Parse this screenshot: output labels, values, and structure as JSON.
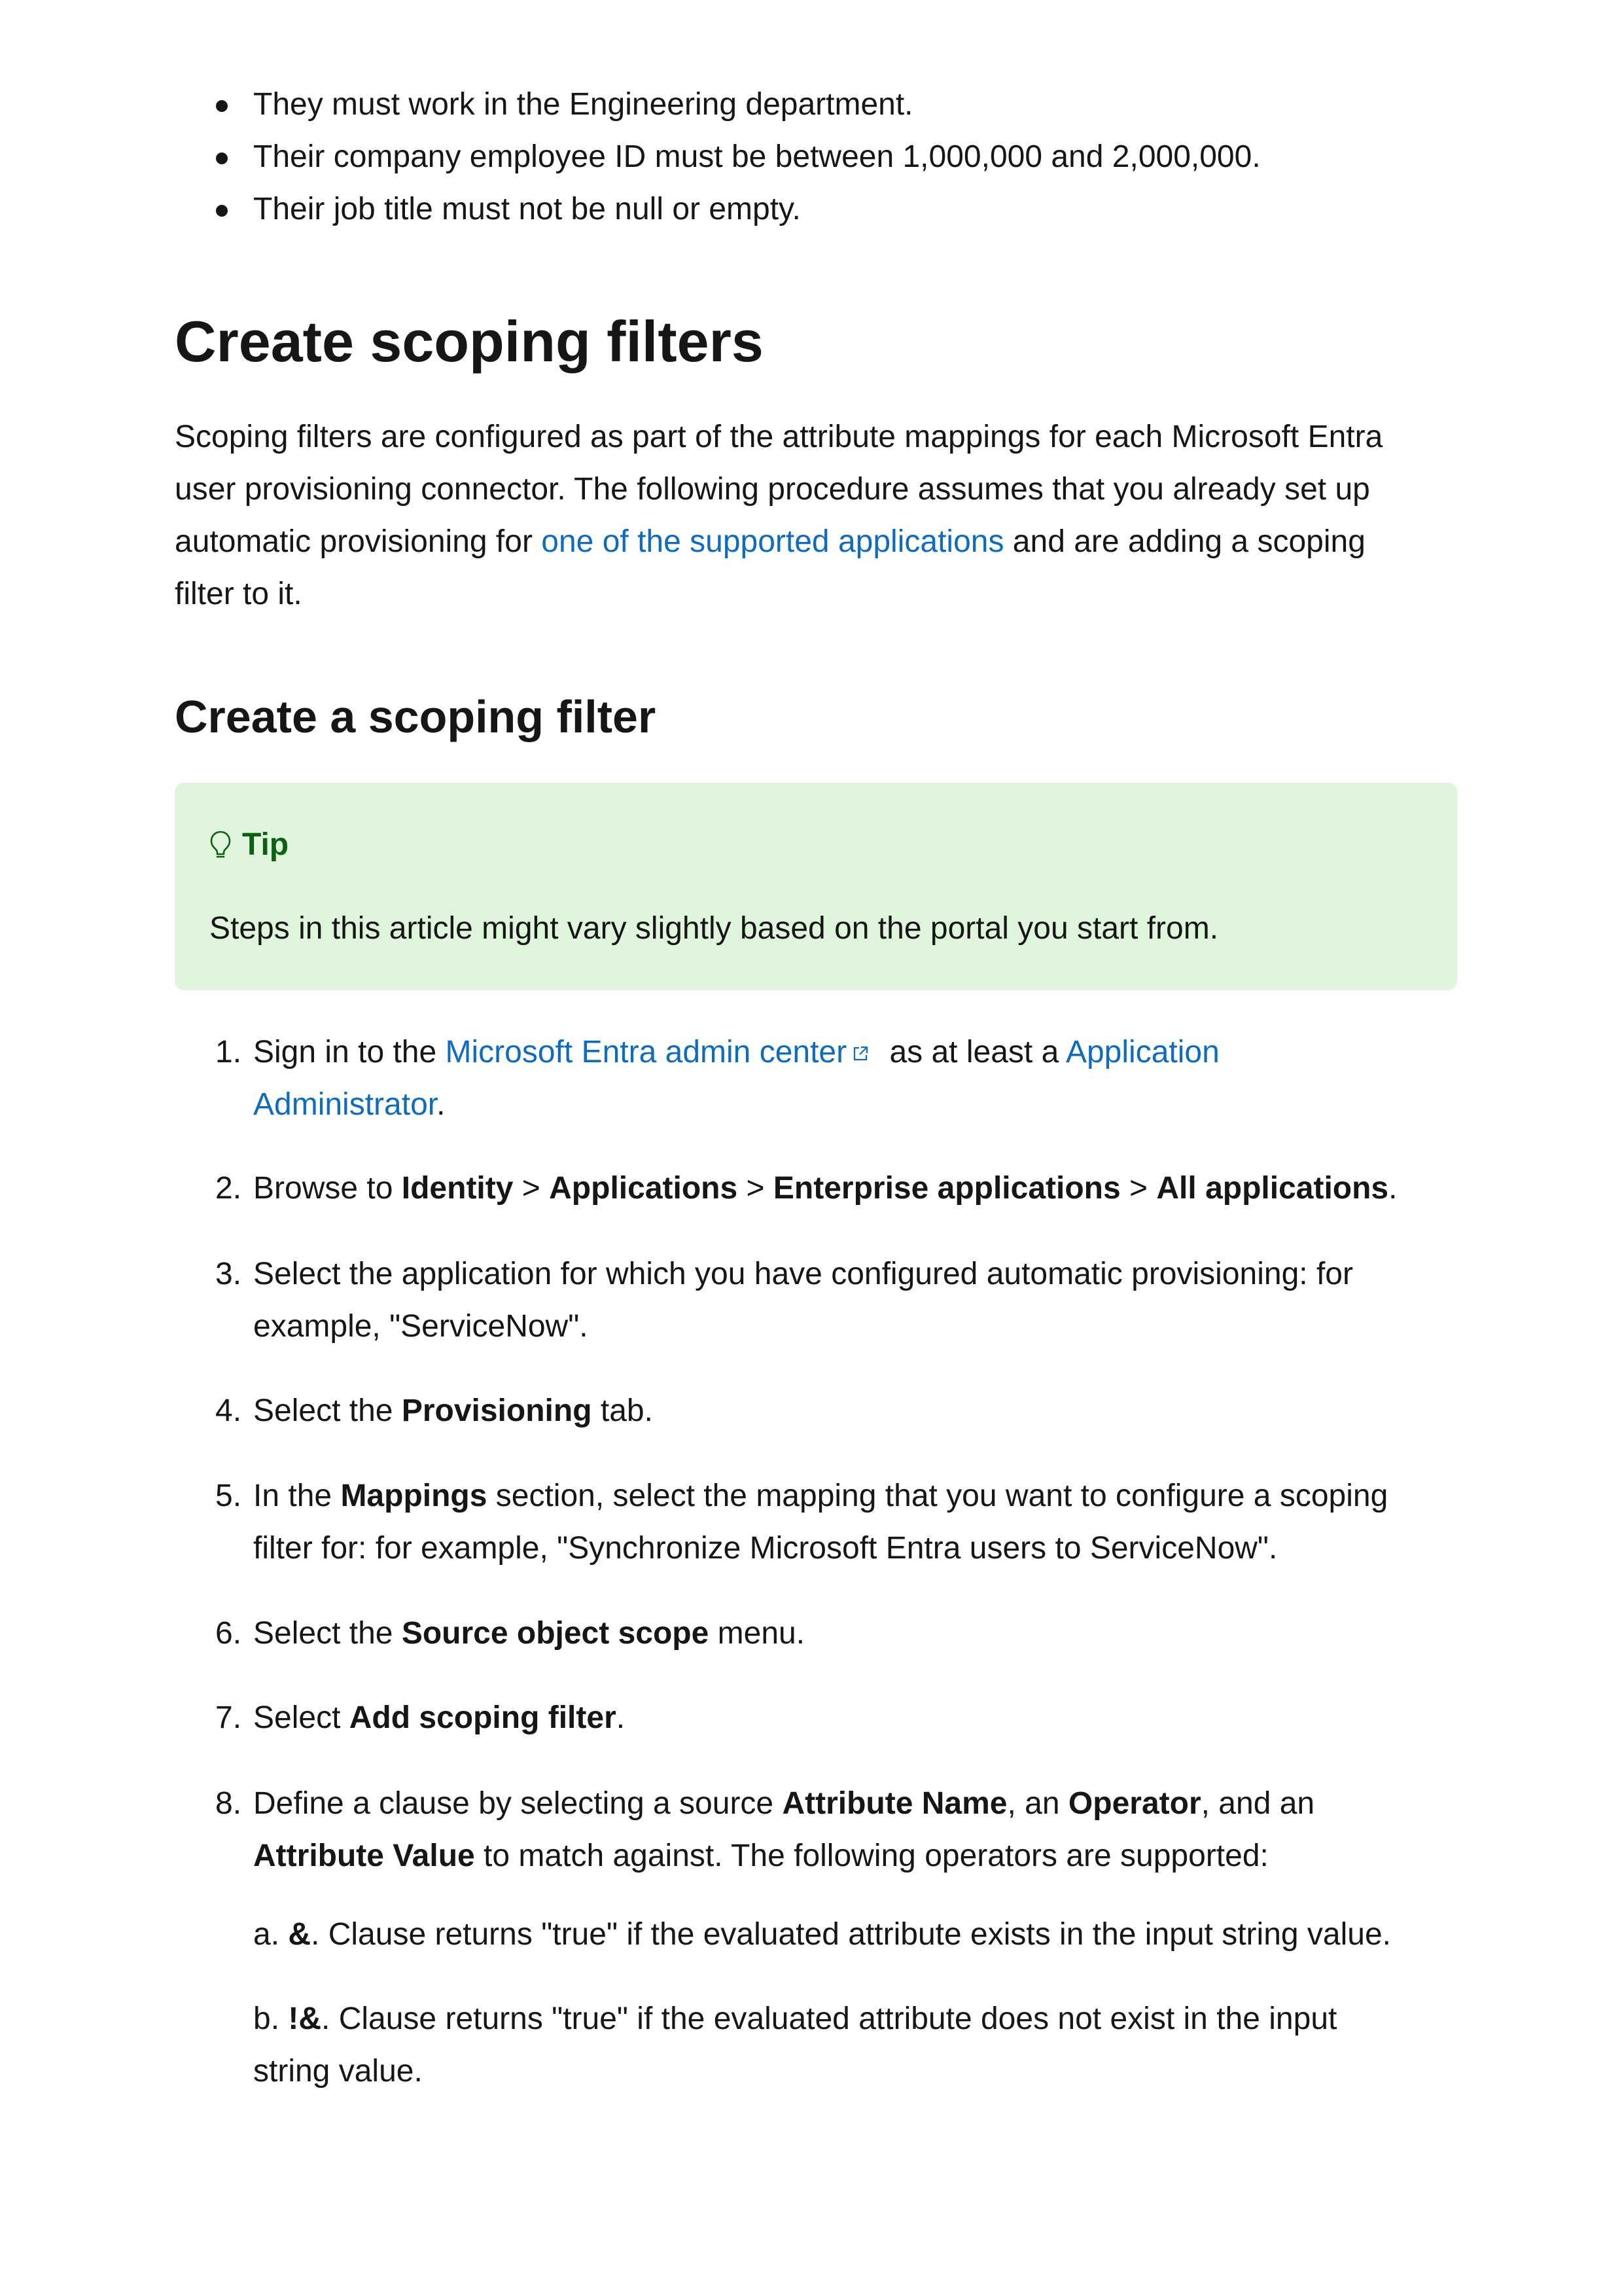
{
  "bullets": [
    "They must work in the Engineering department.",
    "Their company employee ID must be between 1,000,000 and 2,000,000.",
    "Their job title must not be null or empty."
  ],
  "section_title": "Create scoping filters",
  "intro": {
    "line1": "Scoping filters are configured as part of the attribute mappings for each Microsoft Entra",
    "line2": "user provisioning connector. The following procedure assumes that you already set up",
    "line3_before": "automatic provisioning for ",
    "line3_link": "one of the supported applications",
    "line3_after": " and are adding a scoping",
    "line4": "filter to it."
  },
  "subsection_title": "Create a scoping filter",
  "tip": {
    "label": "Tip",
    "icon": "lightbulb-icon",
    "body": "Steps in this article might vary slightly based on the portal you start from.",
    "background": "#dff6dd",
    "accent": "#0e5f13"
  },
  "link_color": "#0f6cbd",
  "steps": {
    "s1": {
      "num": "1.",
      "before": "Sign in to the ",
      "link1": "Microsoft Entra admin center",
      "middle": " as at least a ",
      "link2a": "Application",
      "link2b": "Administrator",
      "after": "."
    },
    "s2": {
      "num": "2.",
      "t1": "Browse to ",
      "b1": "Identity",
      "t2": " > ",
      "b2": "Applications",
      "t3": " > ",
      "b3": "Enterprise applications",
      "t4": " > ",
      "b4": "All applications",
      "t5": "."
    },
    "s3": {
      "num": "3.",
      "line1": "Select the application for which you have configured automatic provisioning: for",
      "line2": "example, \"ServiceNow\"."
    },
    "s4": {
      "num": "4.",
      "t1": "Select the ",
      "b1": "Provisioning",
      "t2": " tab."
    },
    "s5": {
      "num": "5.",
      "t1": "In the ",
      "b1": "Mappings",
      "t2": " section, select the mapping that you want to configure a scoping",
      "line2": "filter for: for example, \"Synchronize Microsoft Entra users to ServiceNow\"."
    },
    "s6": {
      "num": "6.",
      "t1": "Select the ",
      "b1": "Source object scope",
      "t2": " menu."
    },
    "s7": {
      "num": "7.",
      "t1": "Select ",
      "b1": "Add scoping filter",
      "t2": "."
    },
    "s8": {
      "num": "8.",
      "t1": "Define a clause by selecting a source ",
      "b1": "Attribute Name",
      "t2": ", an ",
      "b2": "Operator",
      "t3": ", and an",
      "b3": "Attribute Value",
      "t4": " to match against. The following operators are supported:"
    }
  },
  "operators": {
    "a": {
      "prefix": "a. ",
      "op": "&",
      "text": ". Clause returns \"true\" if the evaluated attribute exists in the input string value."
    },
    "b": {
      "prefix": "b. ",
      "op": "!&",
      "line1": ". Clause returns \"true\" if the evaluated attribute does not exist in the input",
      "line2": "string value."
    }
  }
}
